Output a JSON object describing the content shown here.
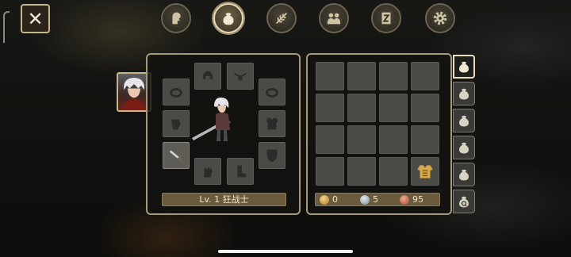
{
  "top_bar": {
    "close_symbol": "✕",
    "tabs": [
      {
        "icon": "character-head-icon",
        "active": false
      },
      {
        "icon": "bag-icon",
        "active": true
      },
      {
        "icon": "skill-feather-icon",
        "active": false
      },
      {
        "icon": "party-icon",
        "active": false
      },
      {
        "icon": "quest-scroll-icon",
        "active": false
      },
      {
        "icon": "settings-gear-icon",
        "active": false
      }
    ]
  },
  "equipment": {
    "slots": [
      {
        "icon": "helmet-icon",
        "equipped": false
      },
      {
        "icon": "amulet-icon",
        "equipped": false
      },
      {
        "icon": "ring-left-icon",
        "equipped": false
      },
      {
        "icon": "ring-right-icon",
        "equipped": false
      },
      {
        "icon": "gauntlet-icon",
        "equipped": false
      },
      {
        "icon": "armor-icon",
        "equipped": false
      },
      {
        "icon": "sword-icon",
        "equipped": true
      },
      {
        "icon": "shield-icon",
        "equipped": false
      },
      {
        "icon": "gloves-icon",
        "equipped": false
      },
      {
        "icon": "boots-icon",
        "equipped": false
      }
    ],
    "level_text": "Lv. 1 狂战士"
  },
  "inventory": {
    "rows": 4,
    "cols": 4,
    "items": [
      {
        "index": 15,
        "icon": "gold-armor-item-icon"
      }
    ],
    "currency": {
      "gold": "0",
      "silver": "5",
      "copper": "95"
    },
    "bag_tabs": [
      {
        "icon": "bag-icon",
        "active": true
      },
      {
        "icon": "bag-icon",
        "active": false
      },
      {
        "icon": "bag-icon",
        "active": false
      },
      {
        "icon": "bag-icon",
        "active": false
      },
      {
        "icon": "bag-icon",
        "active": false
      },
      {
        "icon": "bag-search-icon",
        "active": false
      }
    ]
  },
  "colors": {
    "panel_border": "#a7987a",
    "slot_fill": "#4a4a46",
    "bar_fill": "#6a5a3e",
    "gold": "#d8a84a",
    "silver": "#a8b4c0",
    "copper": "#d07a5a"
  }
}
